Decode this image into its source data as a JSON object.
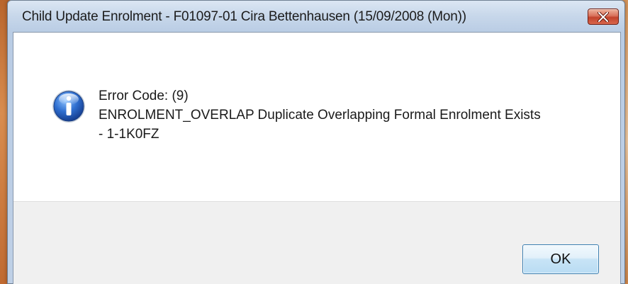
{
  "window": {
    "title": "Child Update Enrolment - F01097-01 Cira Bettenhausen (15/09/2008 (Mon))"
  },
  "titlebar": {
    "close_icon": "close-x-icon",
    "close_color": "#c7462f"
  },
  "message": {
    "icon": "information-icon",
    "lines": [
      "Error Code: (9)",
      "ENROLMENT_OVERLAP Duplicate Overlapping Formal Enrolment Exists",
      "- 1-1K0FZ"
    ]
  },
  "buttons": {
    "ok_label": "OK"
  }
}
